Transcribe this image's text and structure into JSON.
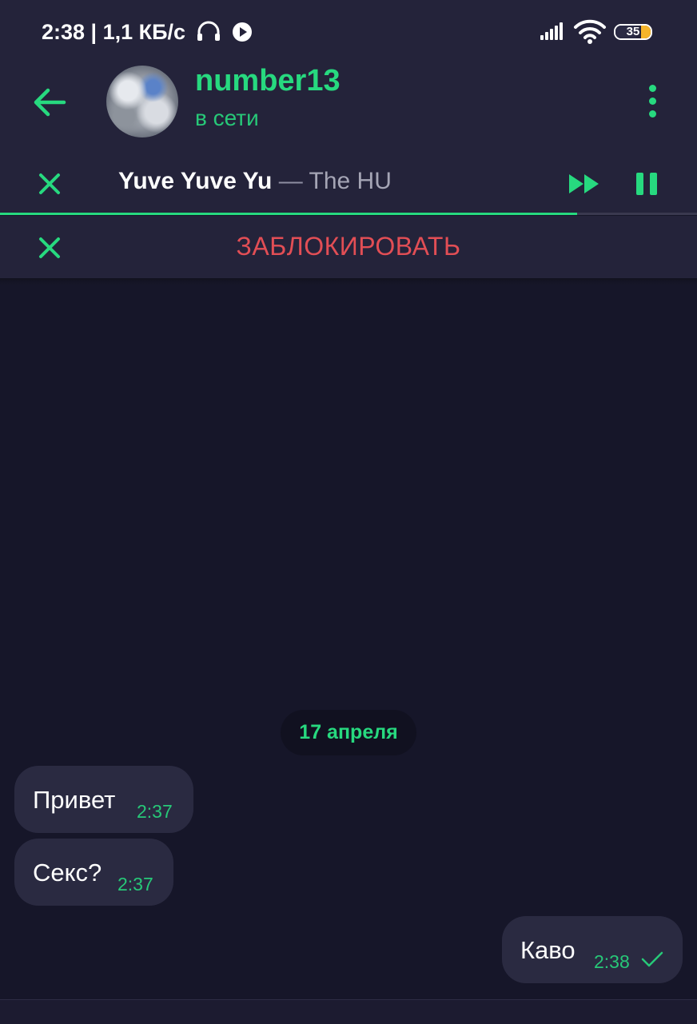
{
  "status_bar": {
    "time_speed": "2:38 | 1,1 КБ/с",
    "battery": "35"
  },
  "header": {
    "contact_name": "number13",
    "contact_status": "в сети"
  },
  "player": {
    "track_title": "Yuve Yuve Yu",
    "separator": " — ",
    "track_artist": "The HU",
    "progress_fraction": 0.828
  },
  "block_bar": {
    "label": "ЗАБЛОКИРОВАТЬ"
  },
  "chat": {
    "date": "17 апреля",
    "messages": [
      {
        "text": "Привет",
        "time": "2:37",
        "direction": "in"
      },
      {
        "text": "Секс?",
        "time": "2:37",
        "direction": "in"
      },
      {
        "text": "Каво",
        "time": "2:38",
        "direction": "out",
        "status": "sent"
      }
    ]
  },
  "colors": {
    "accent": "#27d97f",
    "danger": "#e24e55",
    "header_bg": "#24233a",
    "chat_bg": "#161629",
    "bubble_bg": "#2a2a41"
  }
}
